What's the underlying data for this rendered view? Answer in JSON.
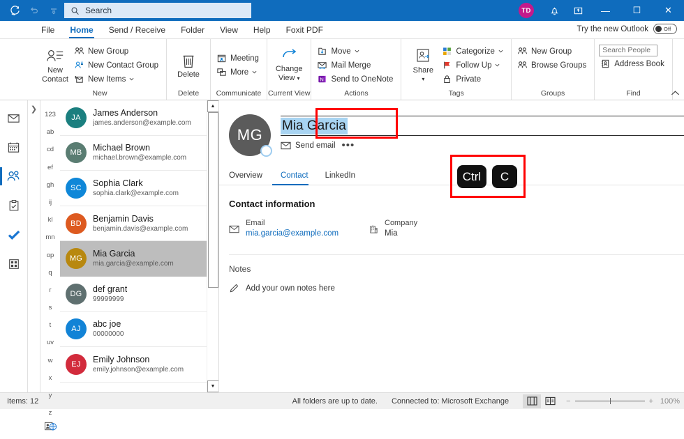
{
  "titlebar": {
    "search_placeholder": "Search",
    "avatar_initials": "TD",
    "avatar_color": "#c4198b",
    "icons": [
      "refresh-icon",
      "undo-icon",
      "customize-qat-icon",
      "search-icon",
      "bell-icon",
      "restore-app-icon"
    ],
    "window_minimize": "—",
    "window_maximize": "☐",
    "window_close": "✕"
  },
  "menubar": {
    "tabs": [
      {
        "label": "File",
        "active": false
      },
      {
        "label": "Home",
        "active": true
      },
      {
        "label": "Send / Receive",
        "active": false
      },
      {
        "label": "Folder",
        "active": false
      },
      {
        "label": "View",
        "active": false
      },
      {
        "label": "Help",
        "active": false
      },
      {
        "label": "Foxit PDF",
        "active": false
      }
    ],
    "try_new_outlook": "Try the new Outlook",
    "toggle_state": "Off"
  },
  "ribbon": {
    "groups": [
      {
        "label": "New",
        "big": {
          "label_line1": "New",
          "label_line2": "Contact",
          "icon": "new-contact-icon"
        },
        "items": [
          {
            "label": "New Group",
            "icon": "new-group-icon",
            "caret": false
          },
          {
            "label": "New Contact Group",
            "icon": "new-contact-group-icon",
            "caret": false
          },
          {
            "label": "New Items",
            "icon": "new-items-icon",
            "caret": true
          }
        ]
      },
      {
        "label": "Delete",
        "big": {
          "label_line1": "Delete",
          "label_line2": "",
          "icon": "trash-icon"
        },
        "items": []
      },
      {
        "label": "Communicate",
        "items": [
          {
            "label": "Meeting",
            "icon": "meeting-icon",
            "caret": false
          },
          {
            "label": "More",
            "icon": "more-communicate-icon",
            "caret": true
          }
        ]
      },
      {
        "label": "Current View",
        "big": {
          "label_line1": "Change",
          "label_line2": "View",
          "icon": "change-view-icon",
          "caret": true
        },
        "items": []
      },
      {
        "label": "Actions",
        "items": [
          {
            "label": "Move",
            "icon": "move-icon",
            "caret": true
          },
          {
            "label": "Mail Merge",
            "icon": "mail-merge-icon",
            "caret": false
          },
          {
            "label": "Send to OneNote",
            "icon": "onenote-icon",
            "caret": false
          }
        ]
      },
      {
        "label": "Tags",
        "big": {
          "label_line1": "Share",
          "label_line2": "",
          "icon": "share-contact-icon",
          "caret": true
        },
        "items": [
          {
            "label": "Categorize",
            "icon": "categorize-icon",
            "caret": true
          },
          {
            "label": "Follow Up",
            "icon": "follow-up-flag-icon",
            "caret": true
          },
          {
            "label": "Private",
            "icon": "lock-icon",
            "caret": false
          }
        ]
      },
      {
        "label": "Groups",
        "items": [
          {
            "label": "New Group",
            "icon": "new-group-icon",
            "caret": false
          },
          {
            "label": "Browse Groups",
            "icon": "browse-groups-icon",
            "caret": false
          }
        ]
      },
      {
        "label": "Find",
        "search_people_placeholder": "Search People",
        "items": [
          {
            "label": "Address Book",
            "icon": "address-book-icon",
            "caret": false
          }
        ]
      }
    ],
    "collapse_icon": "chevron-up-icon"
  },
  "navrail": {
    "items": [
      {
        "name": "mail",
        "icon": "mail-icon",
        "active": false
      },
      {
        "name": "calendar",
        "icon": "calendar-icon",
        "active": false
      },
      {
        "name": "people",
        "icon": "people-icon",
        "active": true
      },
      {
        "name": "tasks",
        "icon": "clipboard-icon",
        "active": false
      },
      {
        "name": "todo",
        "icon": "check-icon",
        "active": false
      },
      {
        "name": "apps",
        "icon": "apps-grid-icon",
        "active": false
      }
    ]
  },
  "alpha_index": [
    "123",
    "ab",
    "cd",
    "ef",
    "gh",
    "ij",
    "kl",
    "mn",
    "op",
    "q",
    "r",
    "s",
    "t",
    "uv",
    "w",
    "x",
    "y",
    "z"
  ],
  "contacts": [
    {
      "initials": "JA",
      "name": "James Anderson",
      "detail": "james.anderson@example.com",
      "color": "#1b7f7f",
      "selected": false
    },
    {
      "initials": "MB",
      "name": "Michael Brown",
      "detail": "michael.brown@example.com",
      "color": "#5a7d72",
      "selected": false
    },
    {
      "initials": "SC",
      "name": "Sophia Clark",
      "detail": "sophia.clark@example.com",
      "color": "#0f87d8",
      "selected": false
    },
    {
      "initials": "BD",
      "name": "Benjamin Davis",
      "detail": "benjamin.davis@example.com",
      "color": "#dd5a20",
      "selected": false
    },
    {
      "initials": "MG",
      "name": "Mia Garcia",
      "detail": "mia.garcia@example.com",
      "color": "#b8880f",
      "selected": true
    },
    {
      "initials": "DG",
      "name": "def grant",
      "detail": "99999999",
      "color": "#5f7070",
      "selected": false
    },
    {
      "initials": "AJ",
      "name": "abc joe",
      "detail": "00000000",
      "color": "#1283d6",
      "selected": false
    },
    {
      "initials": "EJ",
      "name": "Emily Johnson",
      "detail": "emily.johnson@example.com",
      "color": "#d22b3c",
      "selected": false
    }
  ],
  "detail": {
    "avatar_initials": "MG",
    "name": "Mia Garcia",
    "send_email_label": "Send email",
    "more_label": "•••",
    "tabs": [
      {
        "label": "Overview",
        "active": false
      },
      {
        "label": "Contact",
        "active": true
      },
      {
        "label": "LinkedIn",
        "active": false
      }
    ],
    "contact_info_title": "Contact information",
    "email_label": "Email",
    "email_value": "mia.garcia@example.com",
    "company_label": "Company",
    "company_value": "Mia",
    "notes_title": "Notes",
    "notes_placeholder": "Add your own notes here"
  },
  "annotations": {
    "keys": [
      "Ctrl",
      "C"
    ],
    "highlight_color": "#ff0000"
  },
  "status": {
    "items_count": "Items: 12",
    "folders_status": "All folders are up to date.",
    "connection": "Connected to: Microsoft Exchange",
    "zoom_minus": "−",
    "zoom_plus": "+",
    "zoom_level": "100%"
  }
}
